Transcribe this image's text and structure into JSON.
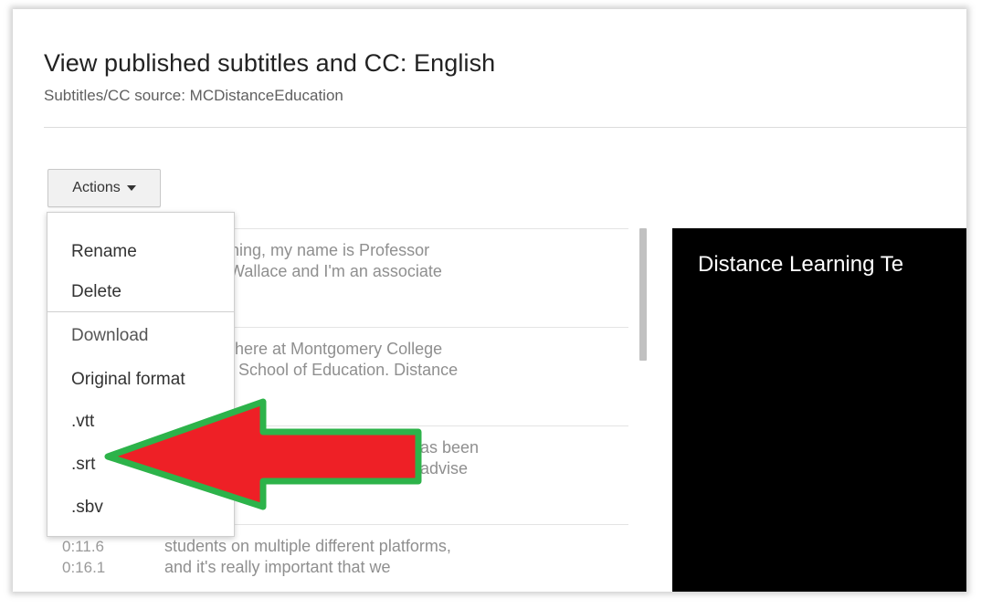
{
  "header": {
    "title": "View published subtitles and CC: English",
    "source": "Subtitles/CC source: MCDistanceEducation"
  },
  "actions": {
    "label": "Actions"
  },
  "menu": {
    "items": [
      {
        "label": "Rename"
      },
      {
        "label": "Delete"
      },
      {
        "label": "Download"
      },
      {
        "label": "Original format"
      },
      {
        "label": ".vtt"
      },
      {
        "label": ".srt"
      },
      {
        "label": ".sbv"
      }
    ]
  },
  "captions": [
    {
      "start": "",
      "end": "",
      "text": "orning, my name is Professor\nn Wallace and I'm an associate"
    },
    {
      "start": "",
      "end": "",
      "text": "or here at Montgomery College\nne School of Education. Distance"
    },
    {
      "start": "",
      "end": "",
      "text": "as been\nadvise"
    },
    {
      "start": "0:11.6",
      "end": "0:16.1",
      "text": "students on multiple different platforms,\nand it's really important that we"
    }
  ],
  "video": {
    "title": "Distance Learning Te"
  },
  "colors": {
    "arrow_fill": "#ee2026",
    "arrow_stroke": "#2db34a",
    "video_bg": "#000000"
  }
}
